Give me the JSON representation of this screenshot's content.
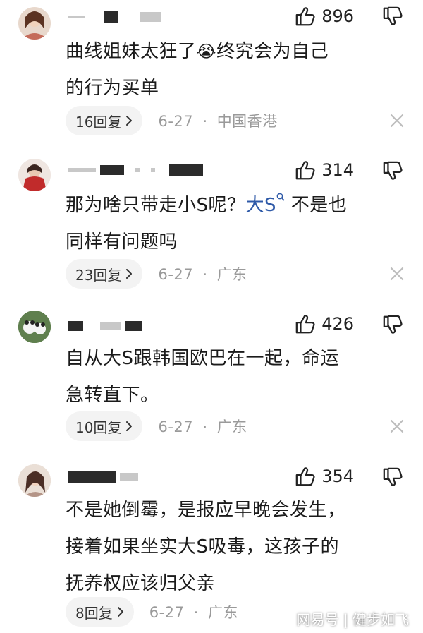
{
  "comments": [
    {
      "likes": "896",
      "lines": [
        "曲线姐妹太狂了",
        "终究会为自己",
        "的行为买单"
      ],
      "emoji": "😭",
      "reply_label": "16回复",
      "date": "6-27",
      "separator": "·",
      "location": "中国香港"
    },
    {
      "likes": "314",
      "line1_prefix": "那为啥只带走小S呢？",
      "tag": "大S",
      "line1_suffix": " 不是也",
      "line2": "同样有问题吗",
      "reply_label": "23回复",
      "date": "6-27",
      "separator": "·",
      "location": "广东"
    },
    {
      "likes": "426",
      "lines": [
        "自从大S跟韩国欧巴在一起，命运",
        "急转直下。"
      ],
      "reply_label": "10回复",
      "date": "6-27",
      "separator": "·",
      "location": "广东"
    },
    {
      "likes": "354",
      "lines": [
        "不是她倒霉，是报应早晚会发生，",
        "接着如果坐实大S吸毒，这孩子的",
        "抚养权应该归父亲"
      ],
      "reply_label": "8回复",
      "date": "6-27",
      "separator": "·",
      "location": "广东"
    }
  ],
  "watermark": "网易号 | 健步如飞",
  "icons": {
    "like": "thumbs-up-icon",
    "dislike": "thumbs-down-icon",
    "reply_chevron": "chevron-right-icon",
    "close": "close-icon",
    "search_tag": "search-icon"
  },
  "colors": {
    "text": "#1b1b1b",
    "meta": "#9a9a9a",
    "tag": "#2f5aa8",
    "reply_bg": "#f3f3f3"
  }
}
